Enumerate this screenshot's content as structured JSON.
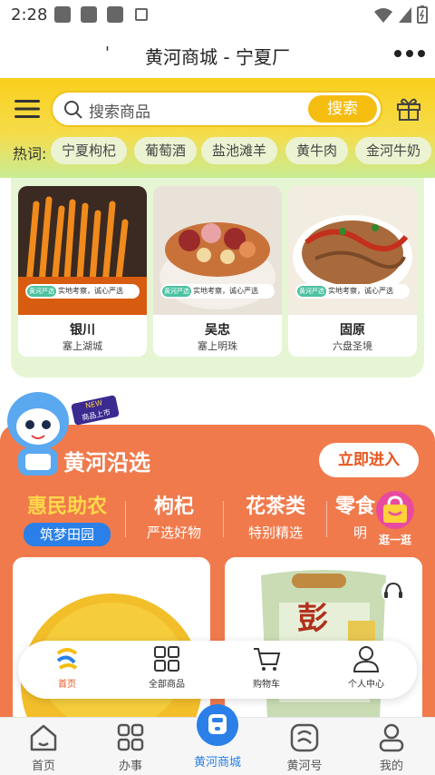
{
  "status_bar": {
    "time": "2:28"
  },
  "title_bar": {
    "title": "黄河商城 - 宁夏厂",
    "left_mark": "'"
  },
  "search": {
    "placeholder": "搜索商品",
    "button": "搜索"
  },
  "hot": {
    "label": "热词:",
    "tags": [
      "宁夏枸杞",
      "葡萄酒",
      "盐池滩羊",
      "黄牛肉",
      "金河牛奶"
    ]
  },
  "regions": [
    {
      "name": "银川",
      "sub": "塞上湖城",
      "badge_brand": "黄河严选",
      "badge_text": "实地考察，诚心严选"
    },
    {
      "name": "吴忠",
      "sub": "塞上明珠",
      "badge_brand": "黄河严选",
      "badge_text": "实地考察，诚心严选"
    },
    {
      "name": "固原",
      "sub": "六盘圣境",
      "badge_brand": "黄河严选",
      "badge_text": "实地考察，诚心严选"
    }
  ],
  "promo": {
    "title": "黄河沿选",
    "enter": "立即进入",
    "mascot_badge": "商品上市",
    "mascot_new": "NEW",
    "float_label": "逛一逛"
  },
  "categories": [
    {
      "title": "惠民助农",
      "desc": "筑梦田园",
      "active": true
    },
    {
      "title": "枸杞",
      "desc": "严选好物",
      "active": false
    },
    {
      "title": "花茶类",
      "desc": "特别精选",
      "active": false
    },
    {
      "title": "零食",
      "desc": "明",
      "active": false
    }
  ],
  "product_label": "彭",
  "mini_nav": [
    "首页",
    "全部商品",
    "购物车",
    "个人中心"
  ],
  "tab_bar": [
    "首页",
    "办事",
    "黄河商城",
    "黄河号",
    "我的"
  ],
  "colors": {
    "accent": "#f5bd10",
    "orange": "#f07a4c",
    "blue": "#2a80e8",
    "active_tab": "#2a80e8"
  }
}
